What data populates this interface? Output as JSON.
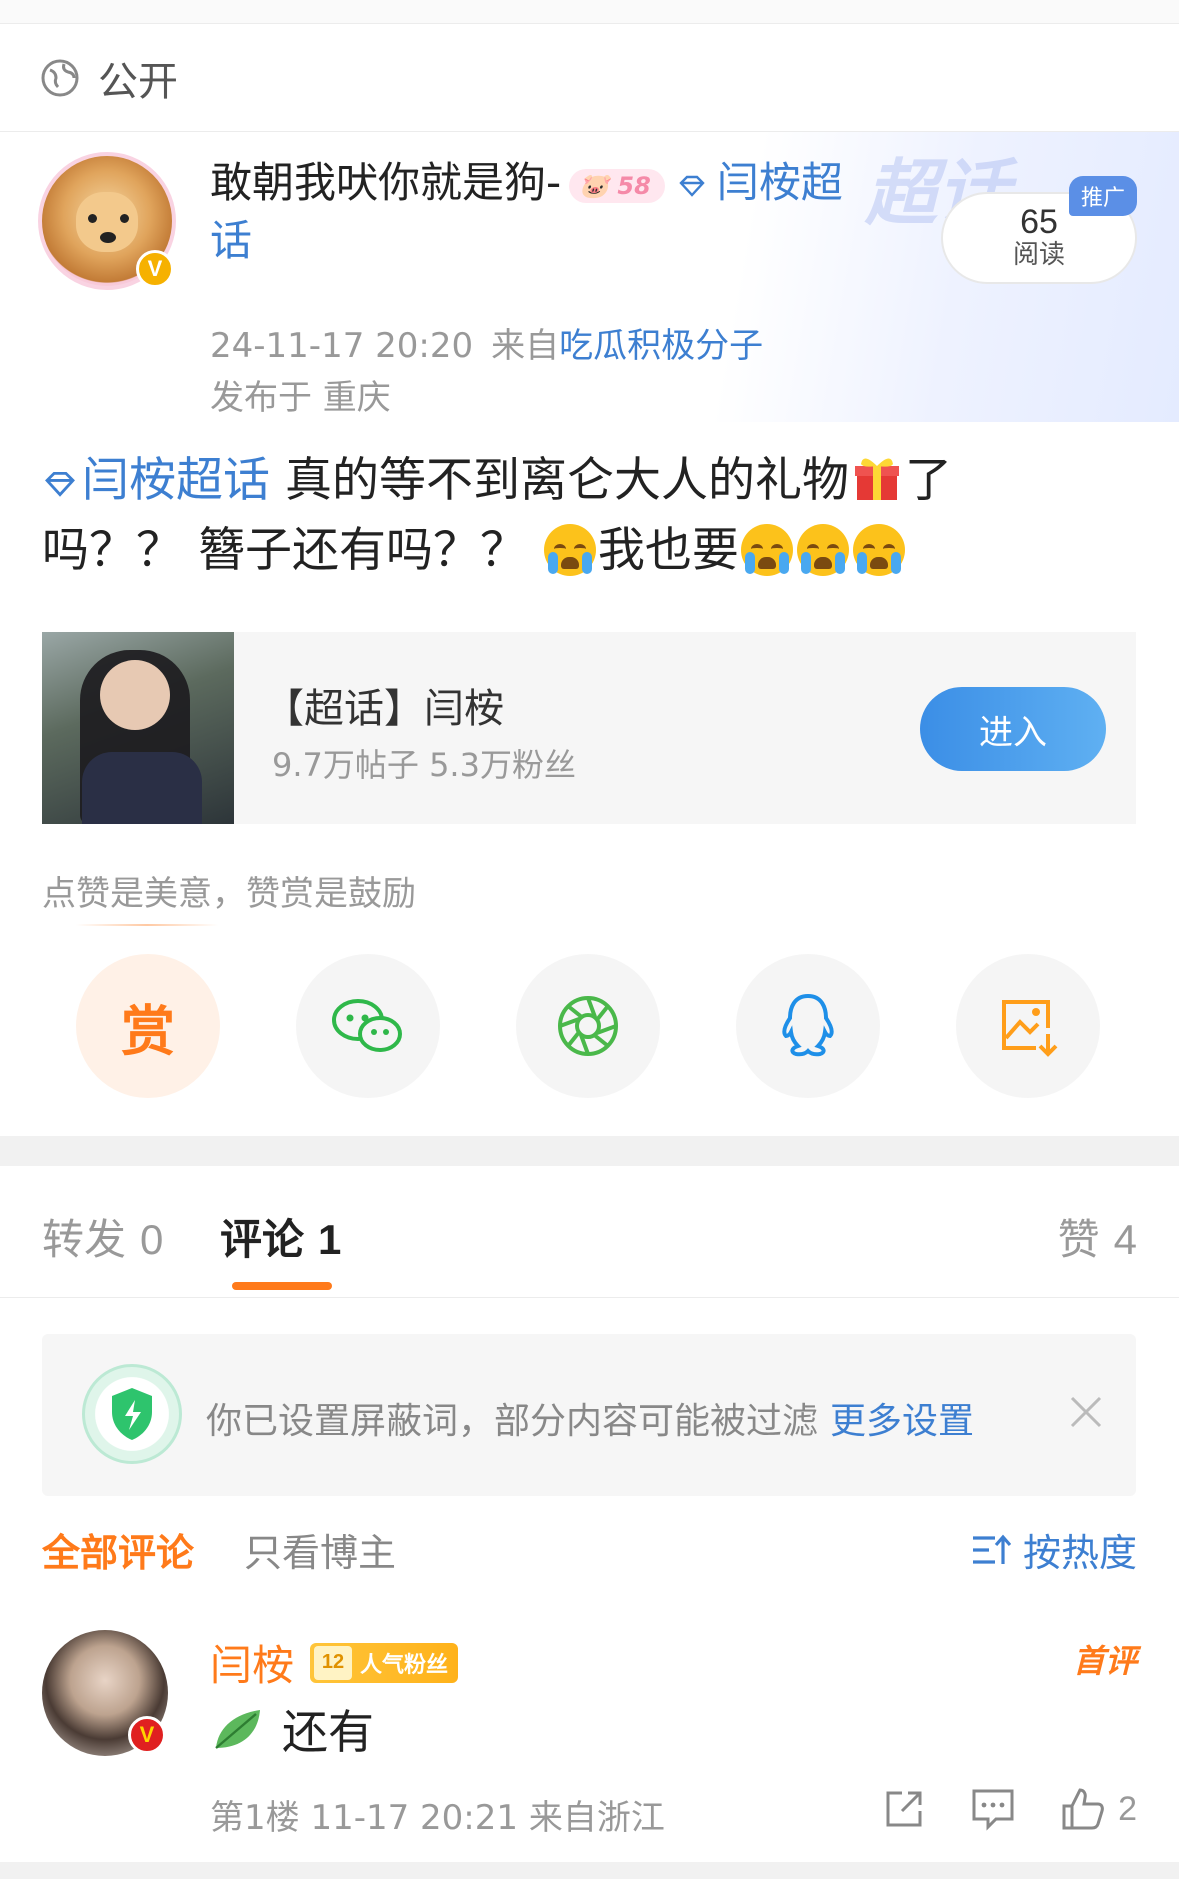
{
  "visibility": {
    "label": "公开",
    "icon": "globe-icon"
  },
  "post": {
    "author": {
      "name": "敢朝我吠你就是狗-",
      "level_tag": "58",
      "topic_prefix": "闫桉超",
      "topic_suffix": "话",
      "verified": true
    },
    "timestamp": "24-11-17 20:20",
    "source_label": "来自",
    "source_app": "吃瓜积极分子",
    "location": "发布于 重庆",
    "read_count": "65",
    "read_label": "阅读",
    "promo_label": "推广",
    "watermark": "超话",
    "body": {
      "topic": "闫桉超话",
      "line1": " 真的等不到离仑大人的礼物",
      "line1_tail": "了",
      "line2": "吗？？ 簪子还有吗？？ ",
      "line2_b": "我也要"
    }
  },
  "topic_card": {
    "title": "【超话】闫桉",
    "stats": "9.7万帖子 5.3万粉丝",
    "enter_label": "进入"
  },
  "reward_hint": "点赞是美意，赞赏是鼓励",
  "share": {
    "reward_label": "赏",
    "items": [
      "reward-button",
      "wechat-icon",
      "moments-icon",
      "qq-icon",
      "save-image-icon"
    ]
  },
  "tabs": {
    "repost": {
      "label": "转发",
      "count": "0"
    },
    "comment": {
      "label": "评论",
      "count": "1"
    },
    "like": {
      "label": "赞",
      "count": "4"
    }
  },
  "filter_notice": {
    "text": "你已设置屏蔽词，部分内容可能被过滤",
    "link": "更多设置"
  },
  "sort": {
    "all": "全部评论",
    "author_only": "只看博主",
    "hot": "按热度"
  },
  "comment": {
    "name": "闫桉",
    "fan_level": "12",
    "fan_label": "人气粉丝",
    "first_label": "首评",
    "text": "还有",
    "meta": "第1楼 11-17 20:21 来自浙江",
    "like_count": "2"
  },
  "colors": {
    "accent": "#ff7a1a",
    "link": "#3d7fd1",
    "enter_button": "#4a9ee8"
  }
}
